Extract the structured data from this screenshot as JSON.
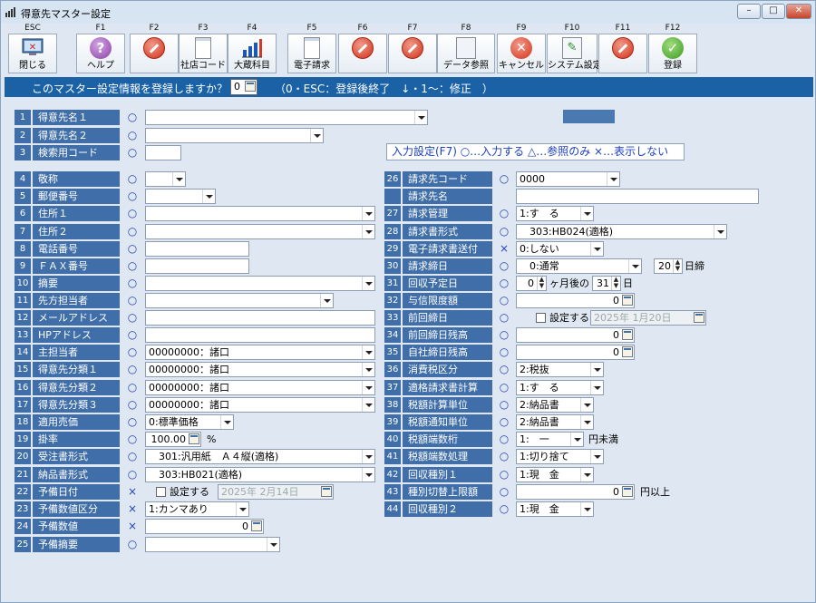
{
  "window": {
    "title": "得意先マスター設定",
    "btn_min": "–",
    "btn_max": "□",
    "btn_close": "✕"
  },
  "toolbar": [
    {
      "key": "ESC",
      "label": "閉じる",
      "icon": "close-window-icon"
    },
    {
      "key": "F1",
      "label": "ヘルプ",
      "icon": "help-icon"
    },
    {
      "key": "F2",
      "label": "",
      "icon": "no-entry-icon"
    },
    {
      "key": "F3",
      "label": "社店コード",
      "icon": "document-icon"
    },
    {
      "key": "F4",
      "label": "大蔵科目",
      "icon": "bar-chart-icon"
    },
    {
      "key": "F5",
      "label": "電子請求",
      "icon": "document-icon"
    },
    {
      "key": "F6",
      "label": "",
      "icon": "no-entry-icon"
    },
    {
      "key": "F7",
      "label": "",
      "icon": "no-entry-icon"
    },
    {
      "key": "F8",
      "label": "データ参照",
      "icon": "data-lookup-icon"
    },
    {
      "key": "F9",
      "label": "キャンセル",
      "icon": "cancel-icon"
    },
    {
      "key": "F10",
      "label": "システム設定",
      "icon": "settings-pencil-icon"
    },
    {
      "key": "F11",
      "label": "",
      "icon": "no-entry-icon"
    },
    {
      "key": "F12",
      "label": "登録",
      "icon": "check-icon"
    }
  ],
  "prompt": {
    "question": "このマスター設定情報を登録しますか？",
    "value": "0",
    "hint": "（0・ESC：登録後終了　↓・1～：修正　）"
  },
  "legend": "入力設定(F7) ○…入力する △…参照のみ ×…表示しない",
  "left_fields": [
    {
      "no": "1",
      "label": "得意先名１",
      "mark": "○",
      "value": ""
    },
    {
      "no": "2",
      "label": "得意先名２",
      "mark": "○",
      "value": ""
    },
    {
      "no": "3",
      "label": "検索用コード",
      "mark": "○",
      "value": ""
    },
    {
      "no": "4",
      "label": "敬称",
      "mark": "○",
      "value": ""
    },
    {
      "no": "5",
      "label": "郵便番号",
      "mark": "○",
      "value": ""
    },
    {
      "no": "6",
      "label": "住所１",
      "mark": "○",
      "value": ""
    },
    {
      "no": "7",
      "label": "住所２",
      "mark": "○",
      "value": ""
    },
    {
      "no": "8",
      "label": "電話番号",
      "mark": "○",
      "value": ""
    },
    {
      "no": "9",
      "label": "ＦＡＸ番号",
      "mark": "○",
      "value": ""
    },
    {
      "no": "10",
      "label": "摘要",
      "mark": "○",
      "value": ""
    },
    {
      "no": "11",
      "label": "先方担当者",
      "mark": "○",
      "value": ""
    },
    {
      "no": "12",
      "label": "メールアドレス",
      "mark": "○",
      "value": ""
    },
    {
      "no": "13",
      "label": "HPアドレス",
      "mark": "○",
      "value": ""
    },
    {
      "no": "14",
      "label": "主担当者",
      "mark": "○",
      "value": "00000000：諸口"
    },
    {
      "no": "15",
      "label": "得意先分類１",
      "mark": "○",
      "value": "00000000：諸口"
    },
    {
      "no": "16",
      "label": "得意先分類２",
      "mark": "○",
      "value": "00000000：諸口"
    },
    {
      "no": "17",
      "label": "得意先分類３",
      "mark": "○",
      "value": "00000000：諸口"
    },
    {
      "no": "18",
      "label": "適用売価",
      "mark": "○",
      "value": "0:標準価格"
    },
    {
      "no": "19",
      "label": "掛率",
      "mark": "○",
      "value": "100.00",
      "suffix": "%"
    },
    {
      "no": "20",
      "label": "受注書形式",
      "mark": "○",
      "value": "　301:汎用紙　Ａ４縦(適格)"
    },
    {
      "no": "21",
      "label": "納品書形式",
      "mark": "○",
      "value": "　303:HB021(適格)"
    },
    {
      "no": "22",
      "label": "予備日付",
      "mark": "×",
      "check_label": "設定する",
      "value": "2025年 2月14日"
    },
    {
      "no": "23",
      "label": "予備数値区分",
      "mark": "×",
      "value": "1:カンマあり"
    },
    {
      "no": "24",
      "label": "予備数値",
      "mark": "×",
      "value": "0"
    },
    {
      "no": "25",
      "label": "予備摘要",
      "mark": "○",
      "value": ""
    }
  ],
  "right_fields": [
    {
      "no": "26",
      "label": "請求先コード",
      "mark": "○",
      "value": "0000"
    },
    {
      "no": "",
      "label": "請求先名",
      "mark": "",
      "value": ""
    },
    {
      "no": "27",
      "label": "請求管理",
      "mark": "○",
      "value": "1:す　る"
    },
    {
      "no": "28",
      "label": "請求書形式",
      "mark": "○",
      "value": "　303:HB024(適格)"
    },
    {
      "no": "29",
      "label": "電子請求書送付",
      "mark": "×",
      "value": "0:しない"
    },
    {
      "no": "30",
      "label": "請求締日",
      "mark": "○",
      "value": "　0:通常",
      "day": "20",
      "day_suffix": "日締"
    },
    {
      "no": "31",
      "label": "回収予定日",
      "mark": "○",
      "value": "0",
      "mid": "ヶ月後の",
      "day": "31",
      "day_suffix": "日"
    },
    {
      "no": "32",
      "label": "与信限度額",
      "mark": "○",
      "value": "0"
    },
    {
      "no": "33",
      "label": "前回締日",
      "mark": "○",
      "check_label": "設定する",
      "value": "2025年 1月20日"
    },
    {
      "no": "34",
      "label": "前回締日残高",
      "mark": "○",
      "value": "0"
    },
    {
      "no": "35",
      "label": "自社締日残高",
      "mark": "○",
      "value": "0"
    },
    {
      "no": "36",
      "label": "消費税区分",
      "mark": "○",
      "value": "2:税抜"
    },
    {
      "no": "37",
      "label": "適格請求書計算",
      "mark": "○",
      "value": "1:す　る"
    },
    {
      "no": "38",
      "label": "税額計算単位",
      "mark": "○",
      "value": "2:納品書"
    },
    {
      "no": "39",
      "label": "税額通知単位",
      "mark": "○",
      "value": "2:納品書"
    },
    {
      "no": "40",
      "label": "税額端数桁",
      "mark": "○",
      "value": "1:　一",
      "suffix": "円未満"
    },
    {
      "no": "41",
      "label": "税額端数処理",
      "mark": "○",
      "value": "1:切り捨て"
    },
    {
      "no": "42",
      "label": "回収種別１",
      "mark": "○",
      "value": "1:現　金"
    },
    {
      "no": "43",
      "label": "種別切替上限額",
      "mark": "○",
      "value": "0",
      "suffix": "円以上"
    },
    {
      "no": "44",
      "label": "回収種別２",
      "mark": "○",
      "value": "1:現　金"
    }
  ]
}
